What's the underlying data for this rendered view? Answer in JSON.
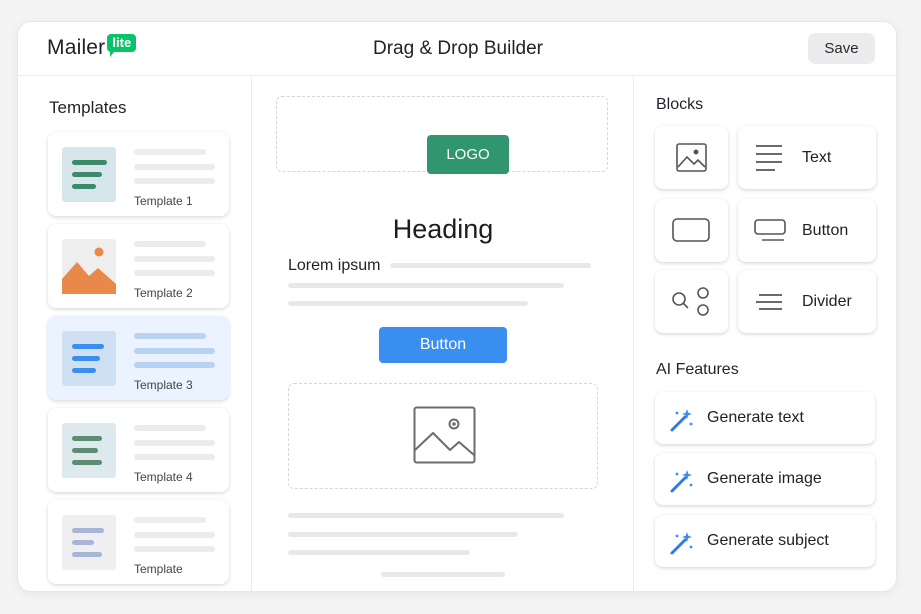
{
  "header": {
    "logo_word": "Mailer",
    "logo_badge": "lite",
    "title": "Drag & Drop Builder",
    "save_label": "Save"
  },
  "templates": {
    "title": "Templates",
    "items": [
      {
        "label": "Template 1",
        "thumb": "text-lines",
        "accent": "#3b8a69",
        "thumb_bg": "#d7e6ec",
        "selected": false
      },
      {
        "label": "Template 2",
        "thumb": "image",
        "accent": "#e8894a",
        "thumb_bg": "#eeeeee",
        "selected": false
      },
      {
        "label": "Template 3",
        "thumb": "text-lines",
        "accent": "#3a8ef0",
        "thumb_bg": "#cfe0f3",
        "selected": true
      },
      {
        "label": "Template 4",
        "thumb": "text-lines",
        "accent": "#5d8c73",
        "thumb_bg": "#dde9ec",
        "selected": false
      },
      {
        "label": "Template",
        "thumb": "text-lines",
        "accent": "#a7b6d6",
        "thumb_bg": "#efeff1",
        "selected": false
      }
    ]
  },
  "canvas": {
    "logo_label": "LOGO",
    "heading": "Heading",
    "lorem": "Lorem ipsum",
    "button_label": "Button"
  },
  "blocks": {
    "title": "Blocks",
    "items": [
      {
        "label": "",
        "icon": "image-icon"
      },
      {
        "label": "Text",
        "icon": "text-lines-icon"
      },
      {
        "label": "",
        "icon": "button-shape-icon"
      },
      {
        "label": "Button",
        "icon": "button-icon"
      },
      {
        "label": "",
        "icon": "social-icons-icon"
      },
      {
        "label": "Divider",
        "icon": "divider-icon"
      }
    ]
  },
  "ai": {
    "title": "AI Features",
    "items": [
      {
        "label": "Generate text",
        "icon": "magic-wand-icon"
      },
      {
        "label": "Generate image",
        "icon": "magic-wand-icon"
      },
      {
        "label": "Generate subject",
        "icon": "magic-wand-icon"
      }
    ]
  },
  "colors": {
    "brand_green": "#09c269",
    "logo_block": "#2f9670",
    "primary_blue": "#3a8ef0",
    "selected_bg": "#eaf3ff"
  }
}
